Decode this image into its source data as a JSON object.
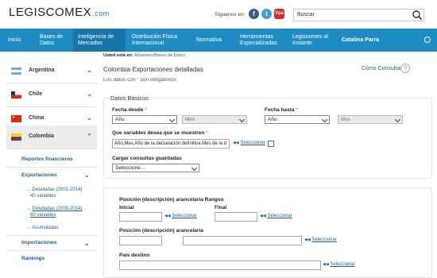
{
  "header": {
    "logo": "LEGISCOMEX",
    "logo_suffix": ".com",
    "follow_text": "Síguenos en:",
    "social": [
      "f",
      "t",
      "You"
    ],
    "search_placeholder": "Buscar"
  },
  "nav": {
    "items": [
      "Inicio",
      "Bases de Datos",
      "Inteligencia de Mercados",
      "Distribución Física Internacional",
      "Normativa",
      "Herramientas Especializadas",
      "Legiscomex al Instante"
    ],
    "user": "Catalina Parra"
  },
  "breadcrumb": {
    "prefix": "Usted está en:",
    "path": "Aduanero/Bases de Datos"
  },
  "sidebar": {
    "countries": [
      "Argentina",
      "Chile",
      "China",
      "Colombia"
    ],
    "reportes": "Reportes financieros",
    "exportaciones": "Exportaciones",
    "detalladas1": "Detalladas (2001-2014)",
    "detalladas1_count": "40 variables",
    "detalladas2": "Detalladas (2008-2014)",
    "detalladas2_count": "60 variables",
    "acumuladas": "Acumuladas",
    "importaciones": "Importaciones",
    "rankings": "Rankings"
  },
  "main": {
    "title": "Colombia-Exportaciones detalladas",
    "required_prefix": "Los datos con",
    "required_star": "*",
    "required_suffix": "son obligatorios",
    "consult_help": "Cómo Consultar",
    "help_icon": "?",
    "basic_legend": "Datos Básicos",
    "fecha_desde": "Fecha desde",
    "fecha_hasta": "Fecha hasta",
    "year_placeholder": "Año",
    "month_placeholder": "Mes",
    "variables_label": "Que variables desea que se muestren",
    "variables_value": "Año,Mes,Año de la declaración definitiva,Mes de la d",
    "select_link": "Seleccionar",
    "saved_label": "Cargar consultas guardadas",
    "saved_placeholder": "Seleccione...",
    "pos_range_label": "Posición (descripción) arancelaria Rangos",
    "inicial": "Inicial",
    "final": "Final",
    "pos_label": "Posición (descripción) arancelaria",
    "pais_label": "País destino"
  }
}
